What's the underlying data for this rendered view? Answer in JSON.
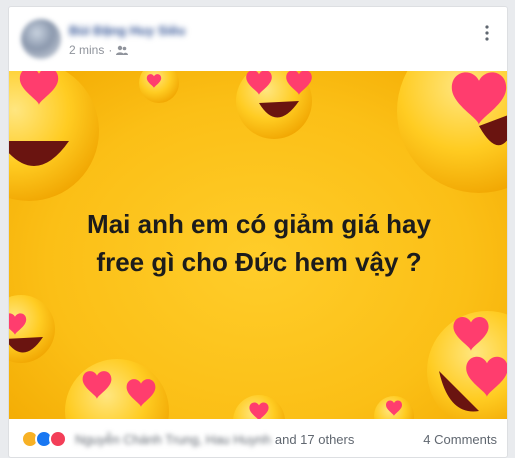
{
  "post": {
    "author": "Bùi Đặng Huy Siêu",
    "time": "2 mins",
    "privacy_icon": "friends-icon",
    "menu_icon": "more-options-icon",
    "image_text_line1": "Mai anh em có giảm giá hay",
    "image_text_line2": "free gì cho Đức hem vậy ?",
    "image_colors": {
      "background": "#fbbf16",
      "emoji_face": "#ffd23c",
      "hearts": "#ff3d6e"
    }
  },
  "footer": {
    "reaction_icons": [
      "haha-icon",
      "like-icon",
      "love-icon"
    ],
    "reactor_names": "Nguyễn Chánh Trung, Hau Huynh",
    "others": "and 17 others",
    "comments": "4 Comments"
  }
}
